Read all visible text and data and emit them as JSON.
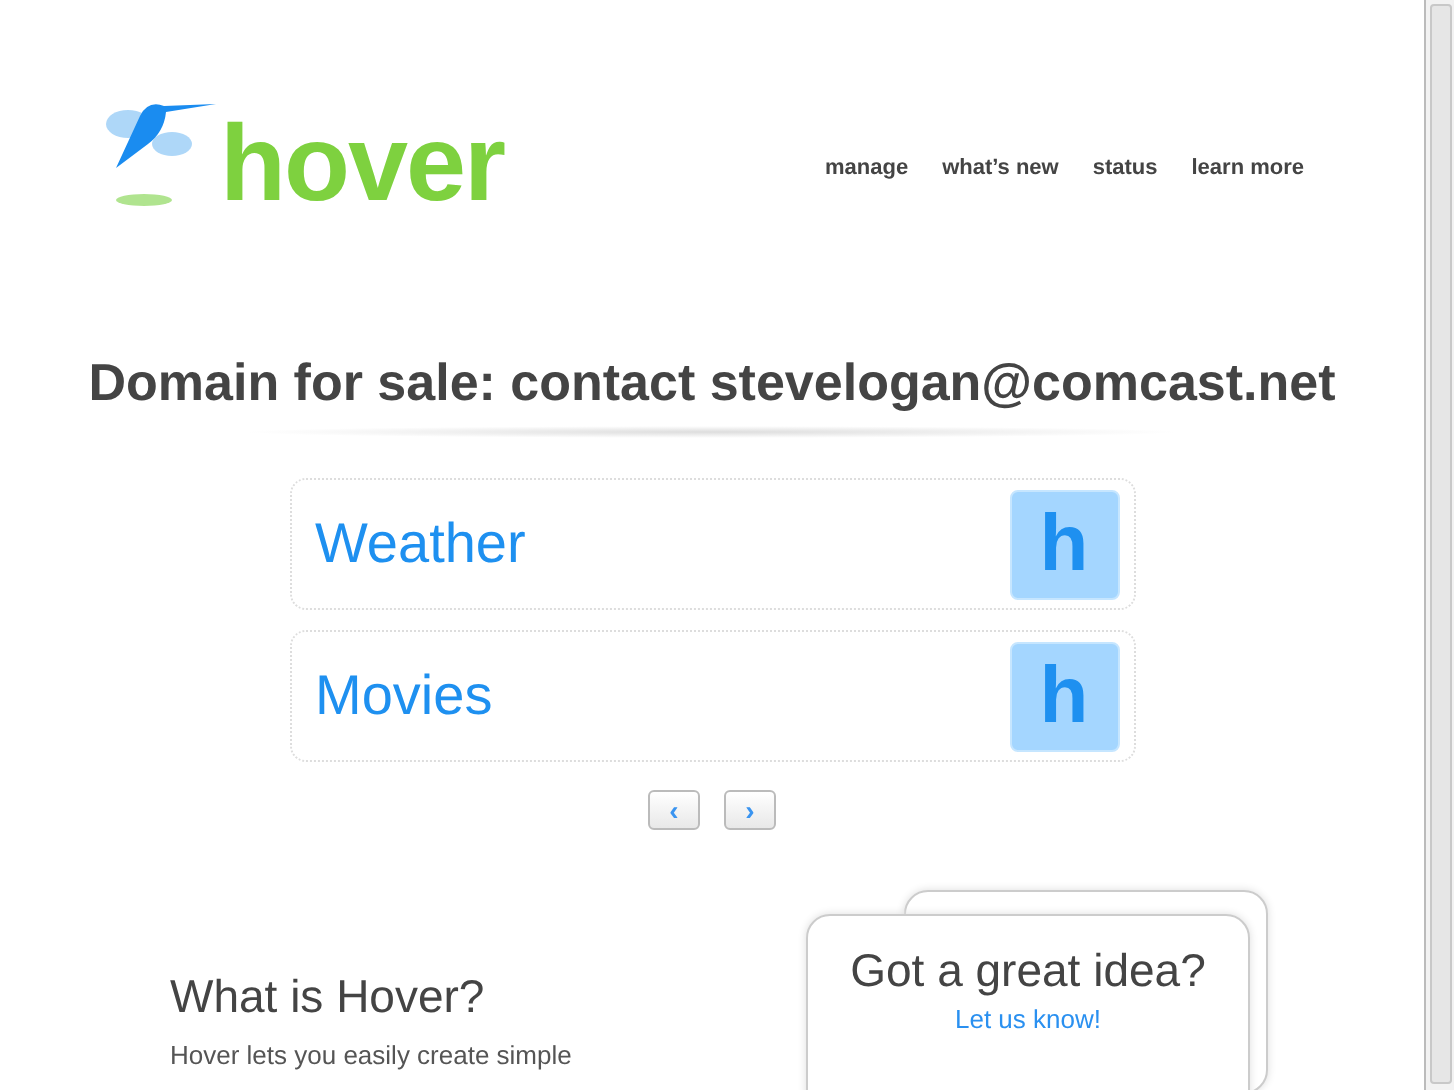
{
  "logo": {
    "text": "hover"
  },
  "nav": [
    {
      "label": "manage"
    },
    {
      "label": "what’s new"
    },
    {
      "label": "status"
    },
    {
      "label": "learn more"
    }
  ],
  "headline": "Domain for sale: contact stevelogan@comcast.net",
  "links": [
    {
      "title": "Weather",
      "badge": "h"
    },
    {
      "title": "Movies",
      "badge": "h"
    }
  ],
  "pager": {
    "prev": "‹",
    "next": "›"
  },
  "about": {
    "title": "What is Hover?",
    "text": "Hover lets you easily create simple"
  },
  "idea": {
    "title": "Got a great idea?",
    "link": "Let us know!"
  }
}
